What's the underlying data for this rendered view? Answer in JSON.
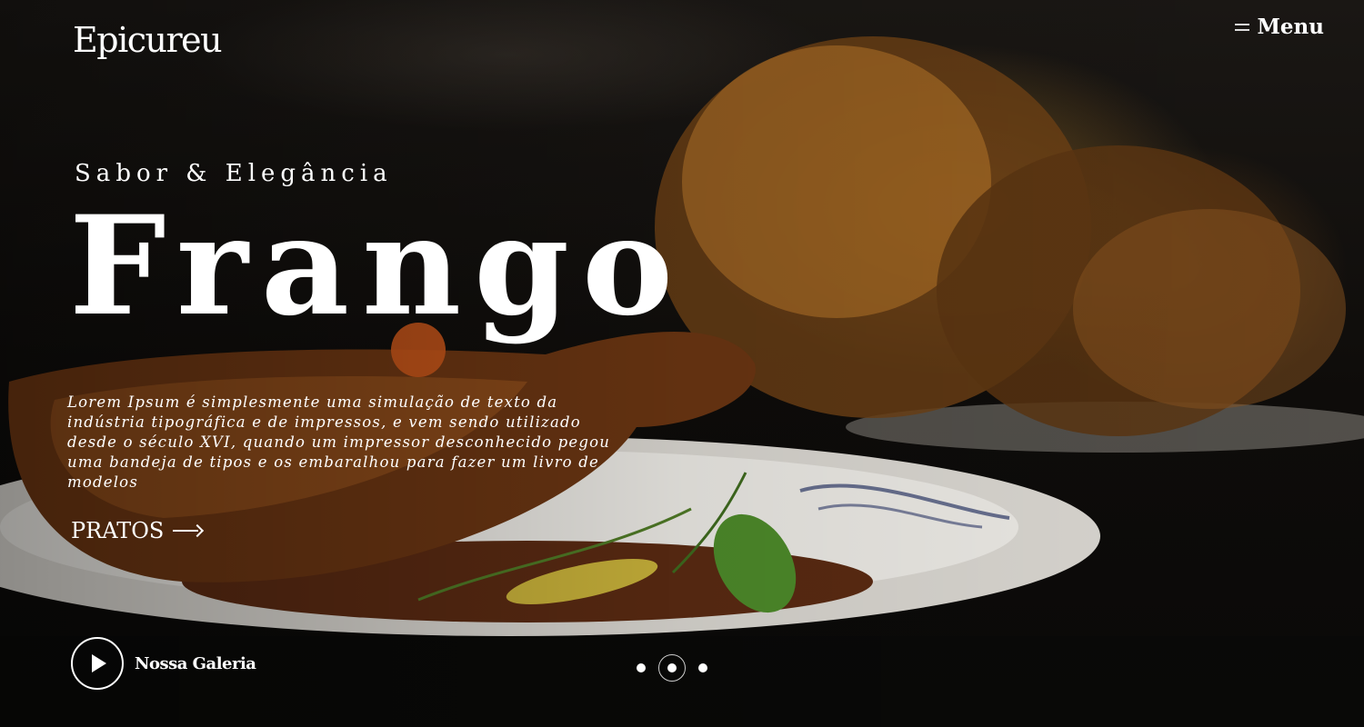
{
  "brand": {
    "logo": "Epicureu"
  },
  "nav": {
    "menu_label": "Menu"
  },
  "hero": {
    "tagline": "Sabor & Elegância",
    "headline": "Frango",
    "description": "Lorem Ipsum é simplesmente uma simulação de texto da indústria tipográfica e de impressos, e vem sendo utilizado desde o século XVI, quando um impressor desconhecido pegou uma bandeja de tipos e os embaralhou para fazer um livro de modelos",
    "cta_label": "PRATOS"
  },
  "gallery": {
    "label": "Nossa Galeria"
  },
  "slider": {
    "count": 3,
    "active_index": 1
  },
  "colors": {
    "text": "#ffffff",
    "background": "#0d0b09",
    "accent": "#c98a35"
  }
}
